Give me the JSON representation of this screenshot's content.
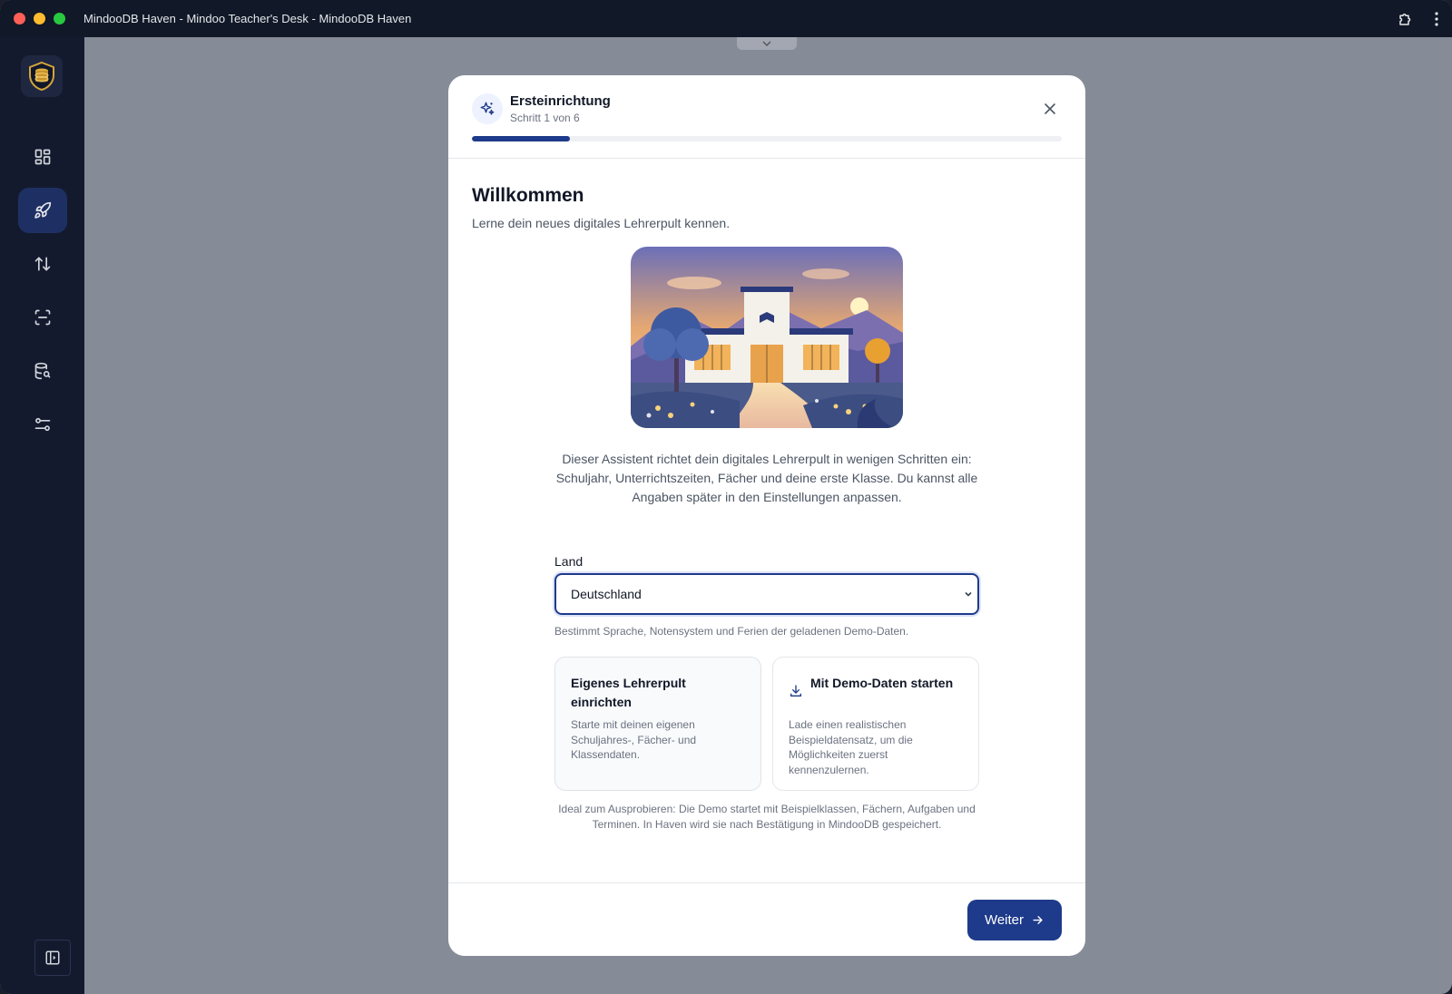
{
  "window": {
    "title": "MindooDB Haven - Mindoo Teacher's Desk - MindooDB Haven"
  },
  "sidebar": {
    "items": [
      {
        "icon": "dashboard-icon",
        "active": false
      },
      {
        "icon": "rocket-icon",
        "active": true
      },
      {
        "icon": "sort-arrows-icon",
        "active": false
      },
      {
        "icon": "scan-icon",
        "active": false
      },
      {
        "icon": "database-search-icon",
        "active": false
      },
      {
        "icon": "settings-sliders-icon",
        "active": false
      }
    ]
  },
  "dialog": {
    "title": "Ersteinrichtung",
    "step_text": "Schritt 1 von 6",
    "step_current": 1,
    "step_total": 6,
    "welcome_title": "Willkommen",
    "welcome_subtitle": "Lerne dein neues digitales Lehrerpult kennen.",
    "intro": "Dieser Assistent richtet dein digitales Lehrerpult in wenigen Schritten ein: Schuljahr, Unterrichtszeiten, Fächer und deine erste Klasse. Du kannst alle Angaben später in den Einstellungen anpassen.",
    "country": {
      "label": "Land",
      "value": "Deutschland",
      "hint": "Bestimmt Sprache, Notensystem und Ferien der geladenen Demo-Daten."
    },
    "options": [
      {
        "title": "Eigenes Lehrerpult einrichten",
        "description": "Starte mit deinen eigenen Schuljahres-, Fächer- und Klassendaten.",
        "selected": true
      },
      {
        "title": "Mit Demo-Daten starten",
        "description": "Lade einen realistischen Beispieldatensatz, um die Möglichkeiten zuerst kennenzulernen.",
        "icon": "download-icon",
        "selected": false
      }
    ],
    "demo_note": "Ideal zum Ausprobieren: Die Demo startet mit Beispielklassen, Fächern, Aufgaben und Terminen. In Haven wird sie nach Bestätigung in MindooDB gespeichert.",
    "next_label": "Weiter"
  },
  "colors": {
    "accent": "#1e3a8a",
    "sidebar_bg": "#141a2e",
    "titlebar_bg": "#111827",
    "backdrop": "#868b98"
  }
}
